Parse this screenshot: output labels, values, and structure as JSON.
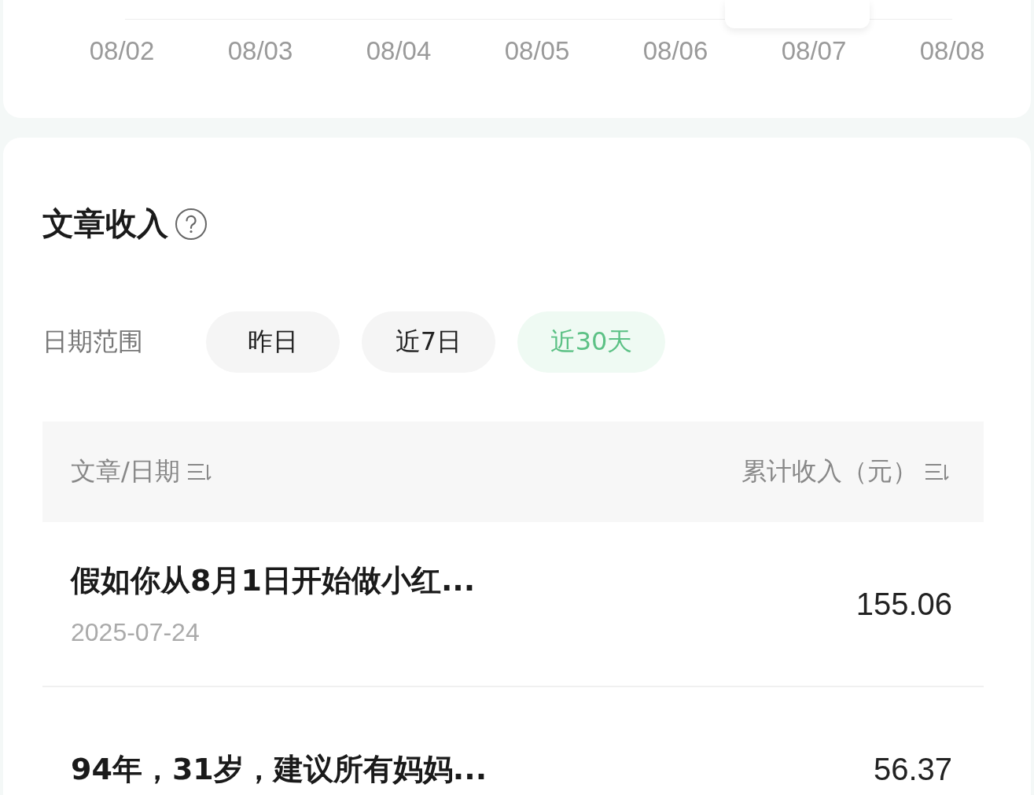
{
  "chart": {
    "x_labels": [
      "08/02",
      "08/03",
      "08/04",
      "08/05",
      "08/06",
      "08/07",
      "08/08"
    ]
  },
  "income": {
    "title": "文章收入",
    "filter_label": "日期范围",
    "ranges": [
      {
        "label": "昨日",
        "selected": false
      },
      {
        "label": "近7日",
        "selected": false
      },
      {
        "label": "近30天",
        "selected": true
      }
    ],
    "columns": [
      "文章/日期",
      "累计收入（元）"
    ],
    "rows": [
      {
        "title": "假如你从8月1日开始做小红...",
        "date": "2025-07-24",
        "amount": "155.06"
      },
      {
        "title": "94年，31岁，建议所有妈妈...",
        "amount": "56.37"
      }
    ]
  }
}
